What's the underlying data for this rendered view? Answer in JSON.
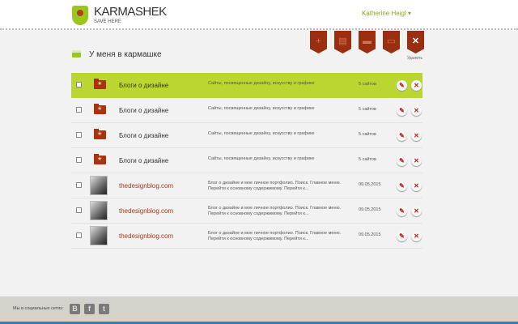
{
  "header": {
    "brand": "KARMASHEK",
    "tagline": "SAVE HERE",
    "user": "Katherine Heigl ▾"
  },
  "toolbar": {
    "icons": [
      "+",
      "▤",
      "▬",
      "▭",
      "✕"
    ],
    "delete_label": "Удалить"
  },
  "section_title": "У меня в кармашке",
  "rows": [
    {
      "name": "Блоги о дизайне",
      "desc": "Сайты, посвященные дизайну, искусству и графике",
      "meta": "5 сайтов"
    },
    {
      "name": "Блоги о дизайне",
      "desc": "Сайты, посвященные дизайну, искусству и графике",
      "meta": "5 сайтов"
    },
    {
      "name": "Блоги о дизайне",
      "desc": "Сайты, посвященные дизайну, искусству и графике",
      "meta": "5 сайтов"
    },
    {
      "name": "Блоги о дизайне",
      "desc": "Сайты, посвященные дизайну, искусству и графике",
      "meta": "5 сайтов"
    },
    {
      "name": "thedesignblog.com",
      "desc": "Блог о дизайне и мое личное портфолио. Поиск. Главное меню. Перейти к основному содержимому. Перейти к...",
      "meta": "09.05.2015"
    },
    {
      "name": "thedesignblog.com",
      "desc": "Блог о дизайне и мое личное портфолио. Поиск. Главное меню. Перейти к основному содержимому. Перейти к...",
      "meta": "09.05.2015"
    },
    {
      "name": "thedesignblog.com",
      "desc": "Блог о дизайне и мое личное портфолио. Поиск. Главное меню. Перейти к основному содержимому. Перейти к...",
      "meta": "09.05.2015"
    }
  ],
  "footer": {
    "social_label": "Мы в социальных сетях:",
    "social": [
      "B",
      "f",
      "t"
    ]
  }
}
